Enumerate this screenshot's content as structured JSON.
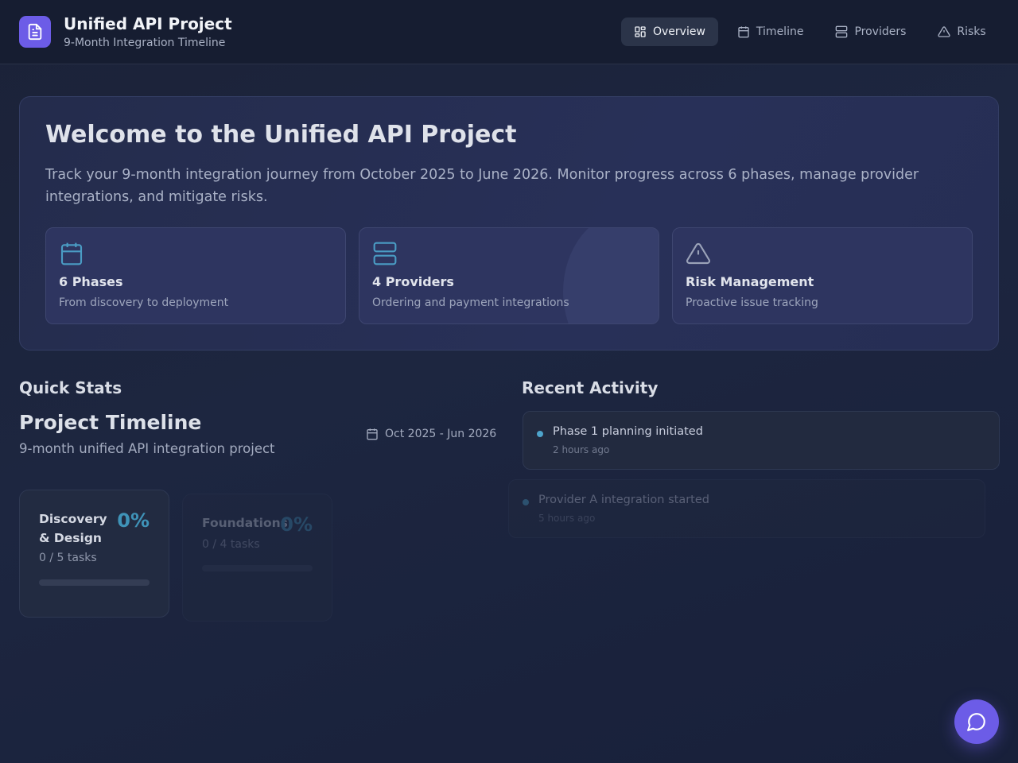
{
  "header": {
    "title": "Unified API Project",
    "subtitle": "9-Month Integration Timeline",
    "logo_icon": "document-icon",
    "nav": [
      {
        "label": "Overview",
        "icon": "dashboard-icon",
        "active": true
      },
      {
        "label": "Timeline",
        "icon": "calendar-icon",
        "active": false
      },
      {
        "label": "Providers",
        "icon": "server-icon",
        "active": false
      },
      {
        "label": "Risks",
        "icon": "warning-icon",
        "active": false
      }
    ]
  },
  "welcome": {
    "title": "Welcome to the Unified API Project",
    "description": "Track your 9-month integration journey from October 2025 to June 2026. Monitor progress across 6 phases, manage provider integrations, and mitigate risks.",
    "features": [
      {
        "icon": "calendar-icon",
        "title": "6 Phases",
        "description": "From discovery to deployment"
      },
      {
        "icon": "server-icon",
        "title": "4 Providers",
        "description": "Ordering and payment integrations"
      },
      {
        "icon": "warning-icon",
        "title": "Risk Management",
        "description": "Proactive issue tracking"
      }
    ]
  },
  "quick_stats": {
    "heading": "Quick Stats",
    "timeline_title": "Project Timeline",
    "timeline_subtitle": "9-month unified API integration project",
    "date_range": "Oct 2025 - Jun 2026",
    "phases": [
      {
        "name": "Discovery & Design",
        "percent": "0%",
        "tasks": "0 / 5 tasks",
        "progress": 0
      },
      {
        "name": "Foundations",
        "percent": "0%",
        "tasks": "0 / 4 tasks",
        "progress": 0
      }
    ]
  },
  "recent_activity": {
    "heading": "Recent Activity",
    "items": [
      {
        "text": "Phase 1 planning initiated",
        "time": "2 hours ago"
      },
      {
        "text": "Provider A integration started",
        "time": "5 hours ago"
      }
    ]
  },
  "chat": {
    "icon": "chat-bubble-icon"
  },
  "colors": {
    "accent": "#6c5ce7",
    "progress": "#3f93b8",
    "activity_dot": "#4ea4cc"
  }
}
